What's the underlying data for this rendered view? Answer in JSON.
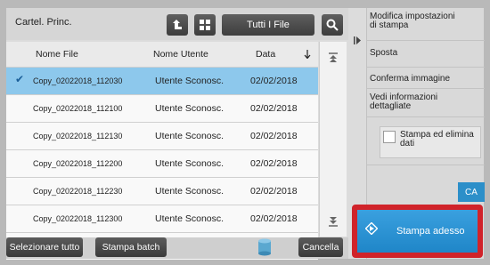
{
  "header": {
    "folder": "Cartel. Princ.",
    "filter": "Tutti I File"
  },
  "columns": {
    "file": "Nome File",
    "user": "Nome Utente",
    "date": "Data"
  },
  "rows": [
    {
      "file": "Copy_02022018_112030",
      "user": "Utente Sconosc.",
      "date": "02/02/2018",
      "selected": true
    },
    {
      "file": "Copy_02022018_112100",
      "user": "Utente Sconosc.",
      "date": "02/02/2018"
    },
    {
      "file": "Copy_02022018_112130",
      "user": "Utente Sconosc.",
      "date": "02/02/2018"
    },
    {
      "file": "Copy_02022018_112200",
      "user": "Utente Sconosc.",
      "date": "02/02/2018"
    },
    {
      "file": "Copy_02022018_112230",
      "user": "Utente Sconosc.",
      "date": "02/02/2018"
    },
    {
      "file": "Copy_02022018_112300",
      "user": "Utente Sconosc.",
      "date": "02/02/2018"
    },
    {
      "file": "Copy_02022018_112330",
      "user": "Utente Sconosc.",
      "date": "02/02/2018"
    }
  ],
  "bottom": {
    "select_all": "Selezionare tutto",
    "batch": "Stampa batch",
    "cancel": "Cancella"
  },
  "panel": {
    "modify_l1": "Modifica impostazioni",
    "modify_l2": "di stampa",
    "move": "Sposta",
    "confirm": "Conferma immagine",
    "details_l1": "Vedi informazioni",
    "details_l2": "dettagliate",
    "print_delete_l1": "Stampa ed elimina",
    "print_delete_l2": "dati",
    "ca": "CA",
    "start": "Stampa adesso"
  },
  "colors": {
    "accent": "#2c8fc9",
    "selected_row": "#8dc8ec",
    "highlight": "#d0232a"
  },
  "icons": [
    "folder-up-icon",
    "grid-icon",
    "search-icon",
    "sort-arrow-icon",
    "scroll-up-icon",
    "scroll-down-icon",
    "panel-toggle-icon",
    "storage-icon",
    "start-icon"
  ]
}
